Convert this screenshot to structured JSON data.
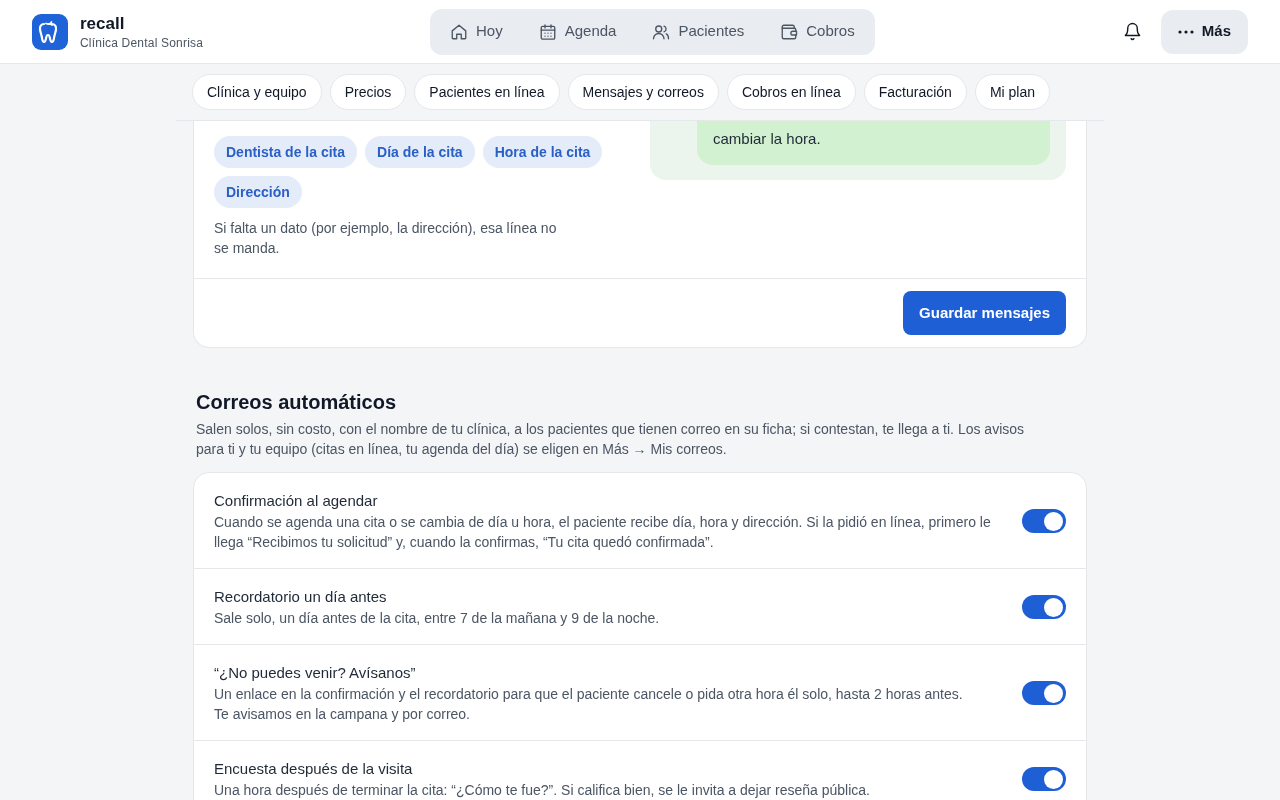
{
  "header": {
    "brand": {
      "name": "recall",
      "subtitle": "Clínica Dental Sonrisa"
    },
    "nav": [
      {
        "label": "Hoy",
        "selected": false
      },
      {
        "label": "Agenda",
        "selected": false
      },
      {
        "label": "Pacientes",
        "selected": false
      },
      {
        "label": "Cobros",
        "selected": false
      }
    ],
    "more_button": {
      "label": "Más"
    }
  },
  "subnav": [
    {
      "label": "Clínica y equipo",
      "selected": false
    },
    {
      "label": "Precios",
      "selected": false
    },
    {
      "label": "Pacientes en línea",
      "selected": false
    },
    {
      "label": "Mensajes y correos",
      "selected": false
    },
    {
      "label": "Cobros en línea",
      "selected": false
    },
    {
      "label": "Facturación",
      "selected": false
    },
    {
      "label": "Mi plan",
      "selected": false
    }
  ],
  "message_card": {
    "chips": [
      "Dentista de la cita",
      "Día de la cita",
      "Hora de la cita",
      "Dirección"
    ],
    "note": "Si falta un dato (por ejemplo, la dirección), esa línea no se manda.",
    "preview_text": "cambiar la hora.",
    "save_button": "Guardar mensajes"
  },
  "emails_section": {
    "title": "Correos automáticos",
    "description": "Salen solos, sin costo, con el nombre de tu clínica, a los pacientes que tienen correo en su ficha; si contestan, te llega a ti. Los avisos para ti y tu equipo (citas en línea, tu agenda del día) se eligen en Más → Mis correos.",
    "rows": [
      {
        "title": "Confirmación al agendar",
        "description": "Cuando se agenda una cita o se cambia de día u hora, el paciente recibe día, hora y dirección. Si la pidió en línea, primero le llega “Recibimos tu solicitud” y, cuando la confirmas, “Tu cita quedó confirmada”.",
        "on": true
      },
      {
        "title": "Recordatorio un día antes",
        "description": "Sale solo, un día antes de la cita, entre 7 de la mañana y 9 de la noche.",
        "on": true
      },
      {
        "title": "“¿No puedes venir? Avísanos”",
        "description": "Un enlace en la confirmación y el recordatorio para que el paciente cancele o pida otra hora él solo, hasta 2 horas antes.\nTe avisamos en la campana y por correo.",
        "on": true
      },
      {
        "title": "Encuesta después de la visita",
        "description": "Una hora después de terminar la cita: “¿Cómo te fue?”. Si califica bien, se le invita a dejar reseña pública.",
        "on": true
      }
    ]
  }
}
